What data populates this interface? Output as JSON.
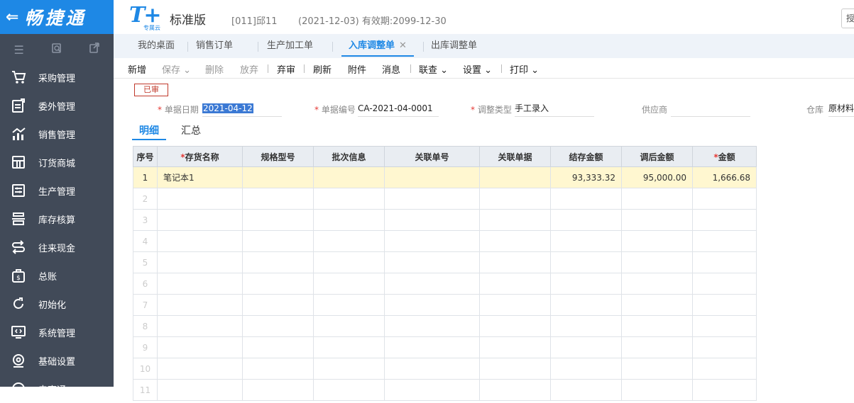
{
  "sidebar": {
    "brand_back": "⇐",
    "brand_name": "畅捷通",
    "tools": [
      "menu-icon",
      "search-doc-icon",
      "export-icon"
    ],
    "items": [
      {
        "label": "采购管理",
        "icon": "purchase-icon"
      },
      {
        "label": "委外管理",
        "icon": "outsource-icon"
      },
      {
        "label": "销售管理",
        "icon": "sales-icon"
      },
      {
        "label": "订货商城",
        "icon": "store-icon"
      },
      {
        "label": "生产管理",
        "icon": "production-icon"
      },
      {
        "label": "库存核算",
        "icon": "inventory-icon"
      },
      {
        "label": "往来现金",
        "icon": "cash-icon"
      },
      {
        "label": "总账",
        "icon": "ledger-icon"
      },
      {
        "label": "初始化",
        "icon": "init-icon"
      },
      {
        "label": "系统管理",
        "icon": "system-icon"
      },
      {
        "label": "基础设置",
        "icon": "settings-icon"
      },
      {
        "label": "电商通",
        "icon": "ecommerce-icon"
      }
    ]
  },
  "header": {
    "logo_text": "T+",
    "logo_sub": "专属云",
    "edition": "标准版",
    "account": "[011]邱11",
    "period": "(2021-12-03)   有效期:2099-12-30",
    "right_button": "授"
  },
  "tabs": [
    {
      "label": "我的桌面",
      "active": false
    },
    {
      "label": "销售订单",
      "active": false
    },
    {
      "label": "生产加工单",
      "active": false
    },
    {
      "label": "入库调整单",
      "active": true
    },
    {
      "label": "出库调整单",
      "active": false
    }
  ],
  "toolbar": {
    "new": "新增",
    "save": "保存",
    "delete": "删除",
    "abandon": "放弃",
    "unaudit": "弃审",
    "refresh": "刷新",
    "attach": "附件",
    "message": "消息",
    "link": "联查",
    "settings": "设置",
    "print": "打印"
  },
  "form": {
    "status": "已审",
    "date_label": "单据日期",
    "date_value": "2021-04-12",
    "code_label": "单据编号",
    "code_value": "CA-2021-04-0001",
    "type_label": "调整类型",
    "type_value": "手工录入",
    "supplier_label": "供应商",
    "supplier_value": "",
    "warehouse_label": "仓库",
    "warehouse_value": "原材料"
  },
  "subtabs": {
    "detail": "明细",
    "summary": "汇总"
  },
  "grid": {
    "columns": [
      "序号",
      "存货名称",
      "规格型号",
      "批次信息",
      "关联单号",
      "关联单据",
      "结存金额",
      "调后金额",
      "金额"
    ],
    "rows": [
      {
        "idx": "1",
        "name": "笔记本1",
        "spec": "",
        "batch": "",
        "ref_no": "",
        "ref_doc": "",
        "balance": "93,333.32",
        "adjusted": "95,000.00",
        "amount": "1,666.68"
      },
      {
        "idx": "2"
      },
      {
        "idx": "3"
      },
      {
        "idx": "4"
      },
      {
        "idx": "5"
      },
      {
        "idx": "6"
      },
      {
        "idx": "7"
      },
      {
        "idx": "8"
      },
      {
        "idx": "9"
      },
      {
        "idx": "10"
      },
      {
        "idx": "11"
      }
    ]
  },
  "colors": {
    "accent": "#1e88e5",
    "sidebar": "#414a58",
    "highlight_row": "#fff7d0",
    "status_red": "#c0392b"
  }
}
